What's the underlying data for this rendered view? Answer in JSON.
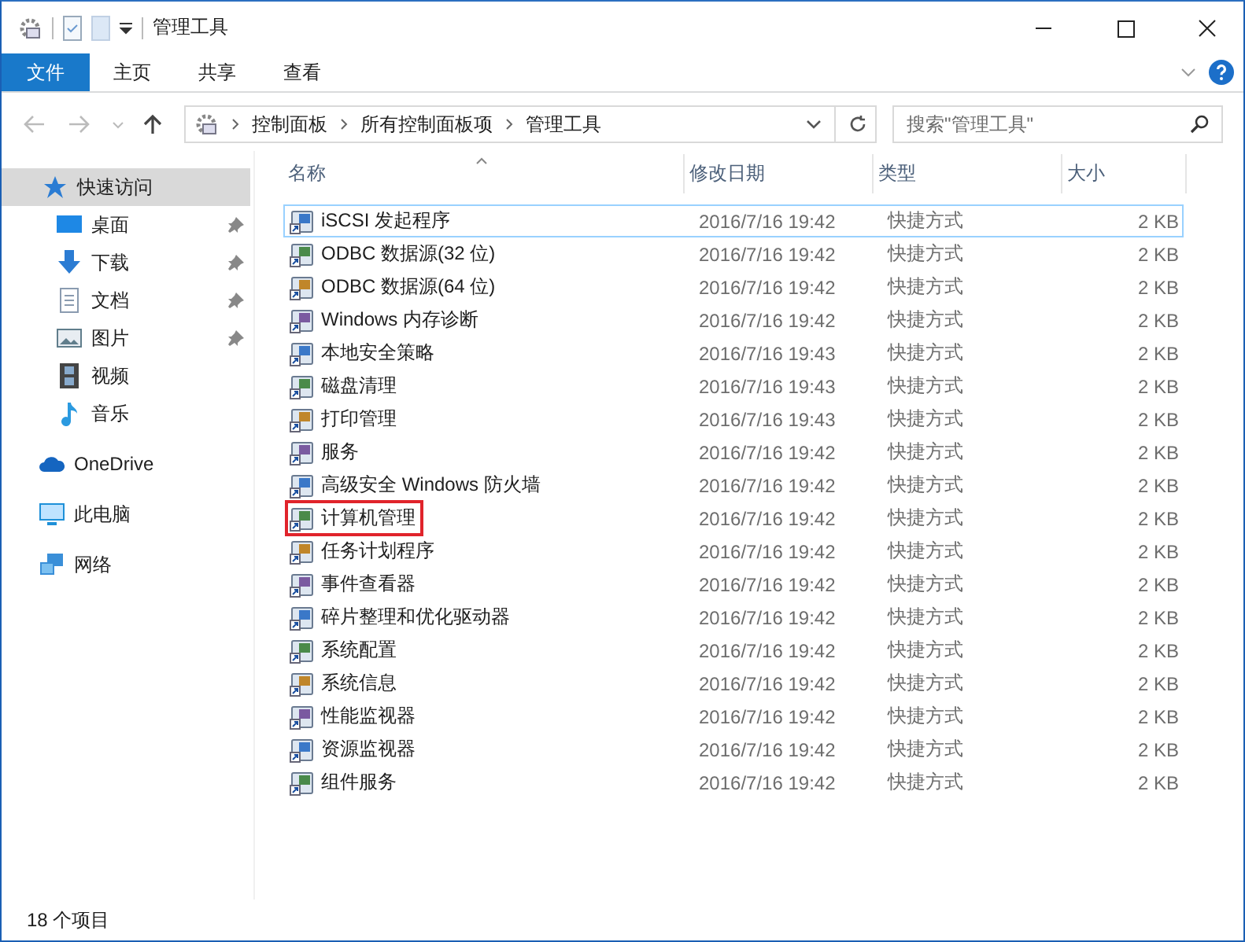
{
  "window": {
    "title": "管理工具"
  },
  "ribbon_tabs": [
    {
      "label": "文件",
      "selected": true
    },
    {
      "label": "主页",
      "selected": false
    },
    {
      "label": "共享",
      "selected": false
    },
    {
      "label": "查看",
      "selected": false
    }
  ],
  "address_bar": {
    "crumbs": [
      "控制面板",
      "所有控制面板项",
      "管理工具"
    ]
  },
  "search": {
    "placeholder": "搜索\"管理工具\""
  },
  "sidebar": {
    "items": [
      {
        "label": "快速访问",
        "selected": true,
        "kind": "quick",
        "children": [
          {
            "label": "桌面",
            "kind": "desktop",
            "pinned": true
          },
          {
            "label": "下载",
            "kind": "download",
            "pinned": true
          },
          {
            "label": "文档",
            "kind": "document",
            "pinned": true
          },
          {
            "label": "图片",
            "kind": "picture",
            "pinned": true
          },
          {
            "label": "视频",
            "kind": "video",
            "pinned": false
          },
          {
            "label": "音乐",
            "kind": "music",
            "pinned": false
          }
        ]
      },
      {
        "label": "OneDrive",
        "selected": false,
        "kind": "cloud"
      },
      {
        "label": "此电脑",
        "selected": false,
        "kind": "pc"
      },
      {
        "label": "网络",
        "selected": false,
        "kind": "network"
      }
    ]
  },
  "table": {
    "columns": [
      "名称",
      "修改日期",
      "类型",
      "大小"
    ],
    "rows": [
      {
        "name": "iSCSI 发起程序",
        "date": "2016/7/16 19:42",
        "type": "快捷方式",
        "size": "2 KB",
        "focused": true,
        "highlighted": false
      },
      {
        "name": "ODBC 数据源(32 位)",
        "date": "2016/7/16 19:42",
        "type": "快捷方式",
        "size": "2 KB",
        "focused": false,
        "highlighted": false
      },
      {
        "name": "ODBC 数据源(64 位)",
        "date": "2016/7/16 19:42",
        "type": "快捷方式",
        "size": "2 KB",
        "focused": false,
        "highlighted": false
      },
      {
        "name": "Windows 内存诊断",
        "date": "2016/7/16 19:42",
        "type": "快捷方式",
        "size": "2 KB",
        "focused": false,
        "highlighted": false
      },
      {
        "name": "本地安全策略",
        "date": "2016/7/16 19:43",
        "type": "快捷方式",
        "size": "2 KB",
        "focused": false,
        "highlighted": false
      },
      {
        "name": "磁盘清理",
        "date": "2016/7/16 19:43",
        "type": "快捷方式",
        "size": "2 KB",
        "focused": false,
        "highlighted": false
      },
      {
        "name": "打印管理",
        "date": "2016/7/16 19:43",
        "type": "快捷方式",
        "size": "2 KB",
        "focused": false,
        "highlighted": false
      },
      {
        "name": "服务",
        "date": "2016/7/16 19:42",
        "type": "快捷方式",
        "size": "2 KB",
        "focused": false,
        "highlighted": false
      },
      {
        "name": "高级安全 Windows 防火墙",
        "date": "2016/7/16 19:42",
        "type": "快捷方式",
        "size": "2 KB",
        "focused": false,
        "highlighted": false
      },
      {
        "name": "计算机管理",
        "date": "2016/7/16 19:42",
        "type": "快捷方式",
        "size": "2 KB",
        "focused": false,
        "highlighted": true
      },
      {
        "name": "任务计划程序",
        "date": "2016/7/16 19:42",
        "type": "快捷方式",
        "size": "2 KB",
        "focused": false,
        "highlighted": false
      },
      {
        "name": "事件查看器",
        "date": "2016/7/16 19:42",
        "type": "快捷方式",
        "size": "2 KB",
        "focused": false,
        "highlighted": false
      },
      {
        "name": "碎片整理和优化驱动器",
        "date": "2016/7/16 19:42",
        "type": "快捷方式",
        "size": "2 KB",
        "focused": false,
        "highlighted": false
      },
      {
        "name": "系统配置",
        "date": "2016/7/16 19:42",
        "type": "快捷方式",
        "size": "2 KB",
        "focused": false,
        "highlighted": false
      },
      {
        "name": "系统信息",
        "date": "2016/7/16 19:42",
        "type": "快捷方式",
        "size": "2 KB",
        "focused": false,
        "highlighted": false
      },
      {
        "name": "性能监视器",
        "date": "2016/7/16 19:42",
        "type": "快捷方式",
        "size": "2 KB",
        "focused": false,
        "highlighted": false
      },
      {
        "name": "资源监视器",
        "date": "2016/7/16 19:42",
        "type": "快捷方式",
        "size": "2 KB",
        "focused": false,
        "highlighted": false
      },
      {
        "name": "组件服务",
        "date": "2016/7/16 19:42",
        "type": "快捷方式",
        "size": "2 KB",
        "focused": false,
        "highlighted": false
      }
    ]
  },
  "status_bar": {
    "count": "18 个项目"
  }
}
